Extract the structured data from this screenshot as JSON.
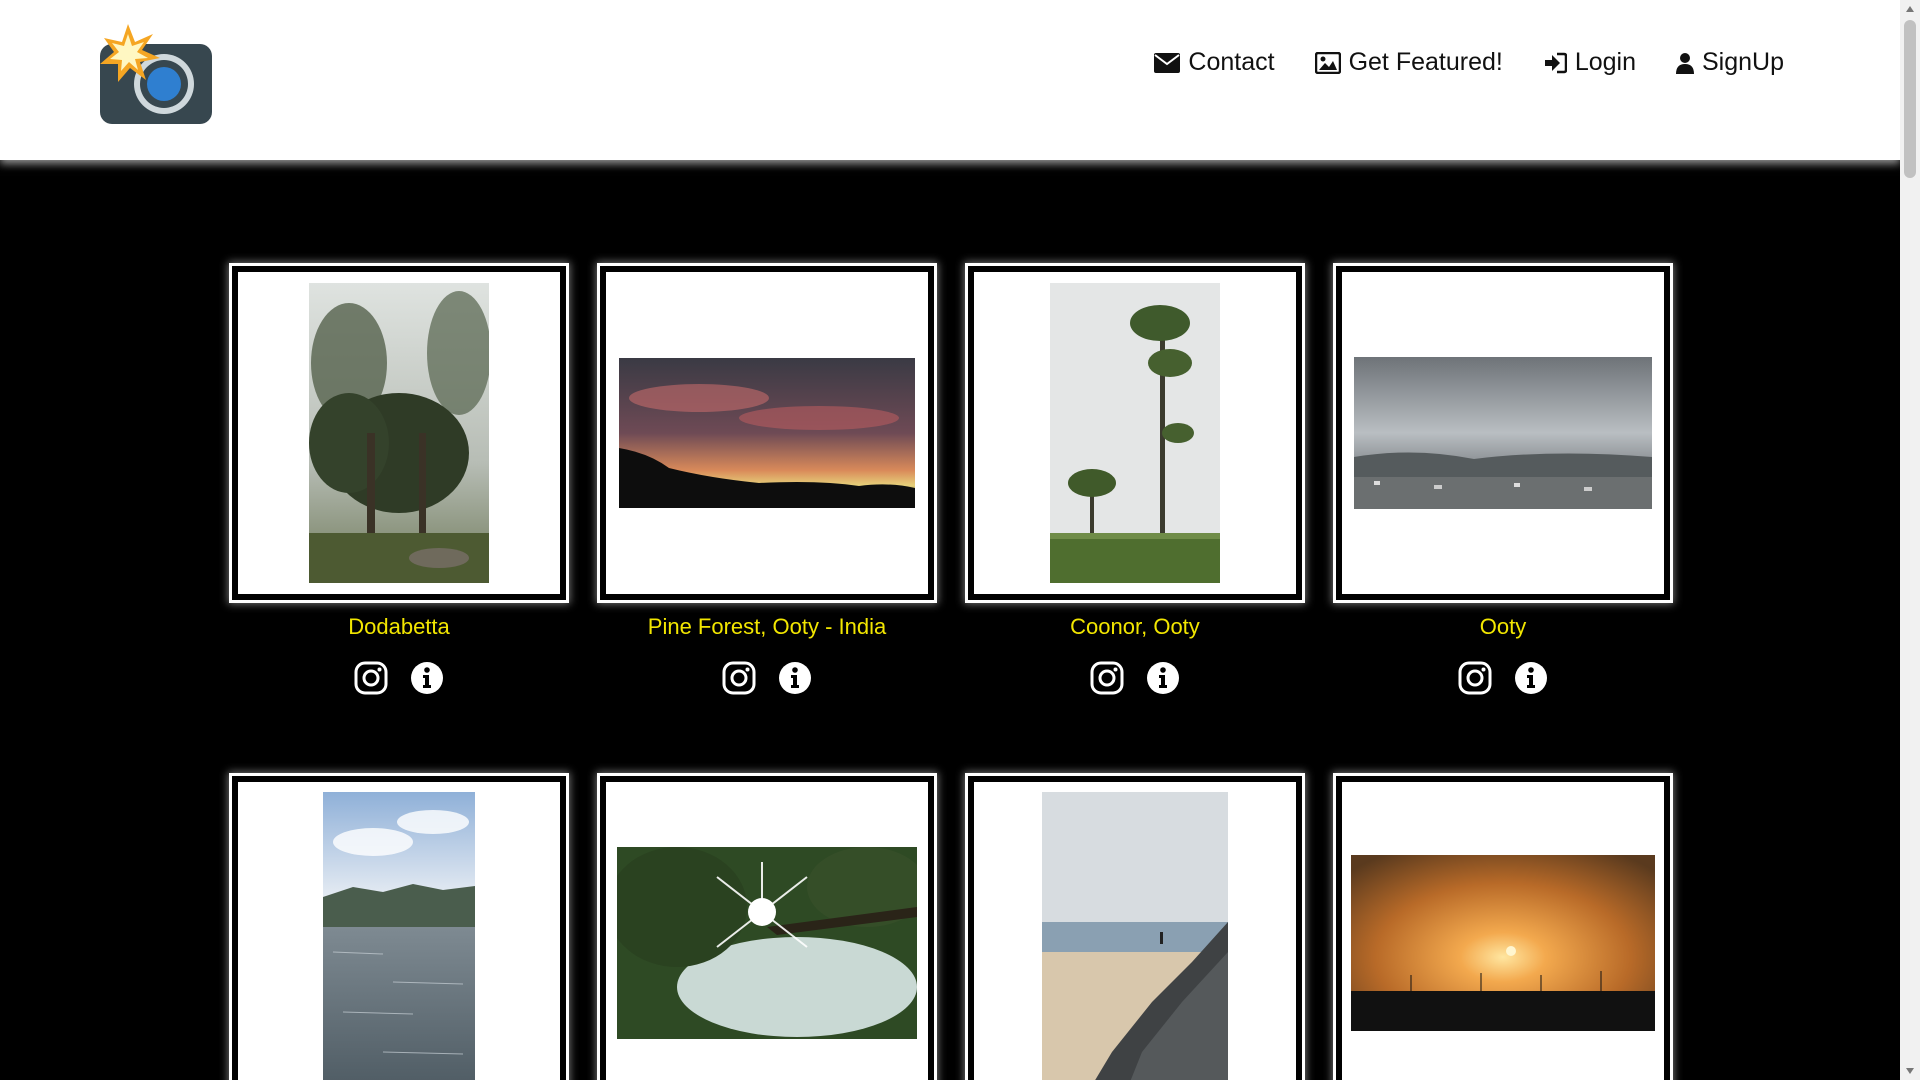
{
  "header": {
    "logo_name": "camera-logo",
    "nav": [
      {
        "label": "Contact",
        "icon": "envelope-icon"
      },
      {
        "label": "Get Featured!",
        "icon": "image-icon"
      },
      {
        "label": "Login",
        "icon": "sign-in-icon"
      },
      {
        "label": "SignUp",
        "icon": "user-icon"
      }
    ]
  },
  "colors": {
    "header_bg": "#ffffff",
    "page_bg": "#000000",
    "caption": "#f2e600",
    "nav_text": "#111111"
  },
  "gallery": {
    "row1": [
      {
        "caption": "Dodabetta",
        "photo": "misty-forest-trees"
      },
      {
        "caption": "Pine Forest, Ooty - India",
        "photo": "sunset-clouds-silhouette"
      },
      {
        "caption": "Coonor, Ooty",
        "photo": "tall-tree-tea-garden"
      },
      {
        "caption": "Ooty",
        "photo": "cloudy-town-hills"
      }
    ],
    "row2": [
      {
        "caption": "",
        "photo": "lake-mountains-sky"
      },
      {
        "caption": "",
        "photo": "sun-through-trees"
      },
      {
        "caption": "",
        "photo": "beach-rocks"
      },
      {
        "caption": "",
        "photo": "orange-sunset"
      }
    ]
  }
}
